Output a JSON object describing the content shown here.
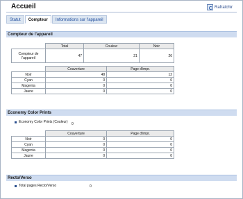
{
  "header": {
    "title": "Accueil",
    "refresh_label": "Rafraîchir"
  },
  "tabs": [
    {
      "label": "Statut"
    },
    {
      "label": "Compteur"
    },
    {
      "label": "Informations sur l'appareil"
    }
  ],
  "counter_section": {
    "title": "Compteur de l'appareil",
    "table1": {
      "headers": [
        "Total",
        "Couleur",
        "Noir"
      ],
      "row_label": "Compteur de l'appareil",
      "values": [
        "47",
        "21",
        "26"
      ]
    },
    "table2": {
      "headers": [
        "Couverture",
        "Page d'impr."
      ],
      "rows": [
        {
          "label": "Noir",
          "coverage": "48",
          "pages": "12"
        },
        {
          "label": "Cyan",
          "coverage": "0",
          "pages": "0"
        },
        {
          "label": "Magenta",
          "coverage": "0",
          "pages": "0"
        },
        {
          "label": "Jaune",
          "coverage": "0",
          "pages": "0"
        }
      ]
    }
  },
  "economy_section": {
    "title": "Economy Color Prints",
    "item_label": "Economy Color Prints (Couleur)",
    "item_value": "0",
    "table": {
      "headers": [
        "Couverture",
        "Page d'impr."
      ],
      "rows": [
        {
          "label": "Noir",
          "coverage": "0",
          "pages": "0"
        },
        {
          "label": "Cyan",
          "coverage": "0",
          "pages": "0"
        },
        {
          "label": "Magenta",
          "coverage": "0",
          "pages": "0"
        },
        {
          "label": "Jaune",
          "coverage": "0",
          "pages": "0"
        }
      ]
    }
  },
  "duplex_section": {
    "title": "Recto/Verso",
    "item_label": "Total pages Recto/Verso",
    "item_value": "0"
  }
}
